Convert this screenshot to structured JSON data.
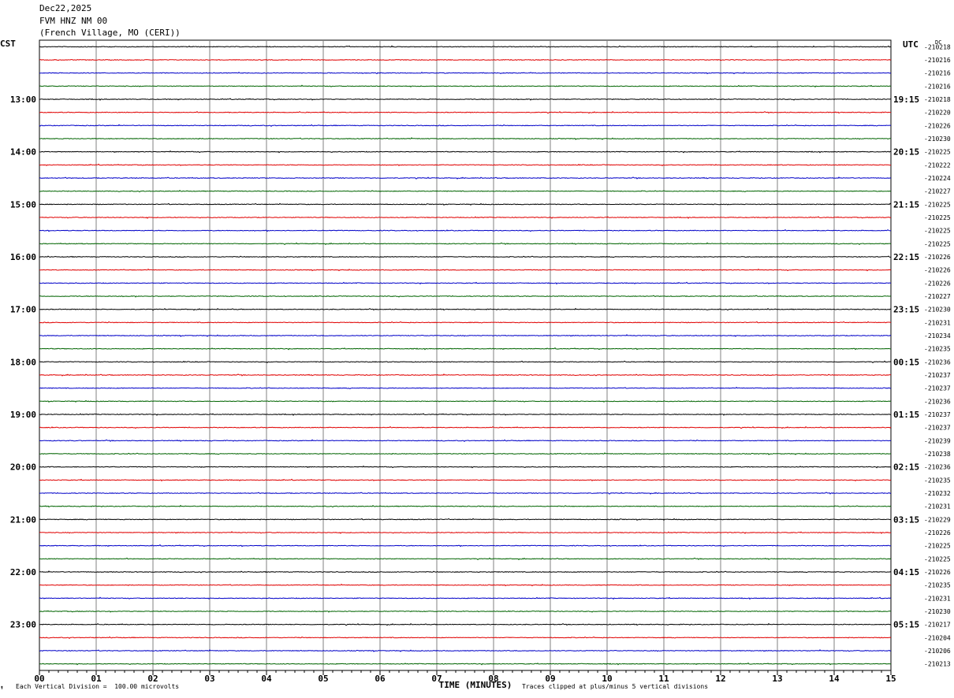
{
  "header": {
    "date": "Dec22,2025",
    "station": "FVM HNZ NM 00",
    "location": "(French Village, MO (CERI))"
  },
  "chart_data": {
    "type": "line",
    "description_of_marks": "helicorder seismogram: 48 traces, 15 minutes each",
    "left_timezone": "CST",
    "right_timezone": "UTC",
    "right_header": "DC",
    "xlabel": "TIME (MINUTES)",
    "xticks": [
      "00",
      "01",
      "02",
      "03",
      "04",
      "05",
      "06",
      "07",
      "08",
      "09",
      "10",
      "11",
      "12",
      "13",
      "14",
      "15"
    ],
    "xlim": [
      0,
      15
    ],
    "left_hour_labels": [
      "13:00",
      "14:00",
      "15:00",
      "16:00",
      "17:00",
      "18:00",
      "19:00",
      "20:00",
      "21:00",
      "22:00",
      "23:00"
    ],
    "right_hour_labels": [
      "19:15",
      "20:15",
      "21:15",
      "22:15",
      "23:15",
      "00:15",
      "01:15",
      "02:15",
      "03:15",
      "04:15",
      "05:15"
    ],
    "trace_colors": [
      "#000000",
      "#e00000",
      "#0000c8",
      "#006400"
    ],
    "dc_offsets": [
      "-210218",
      "-210216",
      "-210216",
      "-210216",
      "-210218",
      "-210220",
      "-210226",
      "-210230",
      "-210225",
      "-210222",
      "-210224",
      "-210227",
      "-210225",
      "-210225",
      "-210225",
      "-210225",
      "-210226",
      "-210226",
      "-210226",
      "-210227",
      "-210230",
      "-210231",
      "-210234",
      "-210235",
      "-210236",
      "-210237",
      "-210237",
      "-210236",
      "-210237",
      "-210237",
      "-210239",
      "-210238",
      "-210236",
      "-210235",
      "-210232",
      "-210231",
      "-210229",
      "-210226",
      "-210225",
      "-210225",
      "-210226",
      "-210235",
      "-210231",
      "-210230",
      "-210217",
      "-210204",
      "-210206",
      "-210213"
    ],
    "scale_note": "Each Vertical Division =  100.00 microvolts",
    "clip_note": "Traces clipped at plus/minus 5 vertical divisions"
  }
}
